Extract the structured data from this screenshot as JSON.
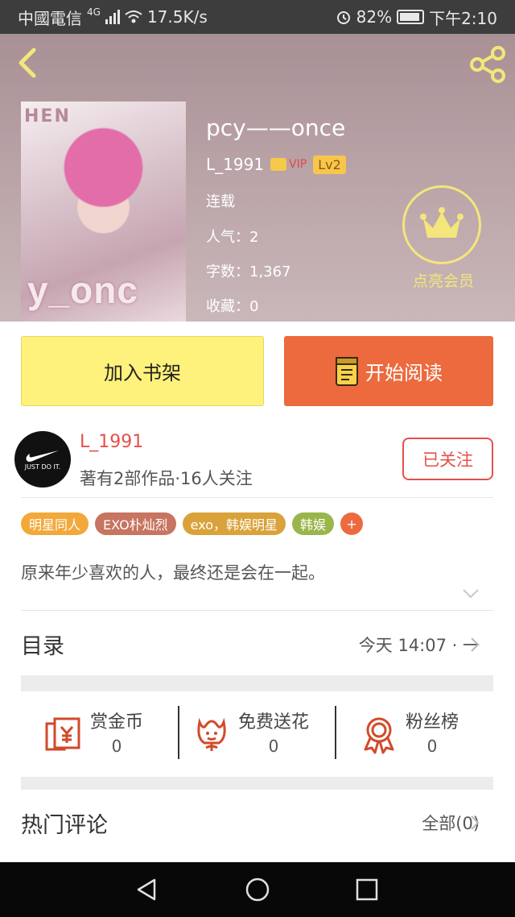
{
  "status_bar": {
    "carrier": "中國電信",
    "network": "4G",
    "speed": "17.5K/s",
    "battery": "82%",
    "time": "下午2:10"
  },
  "book": {
    "title": "pcy——once",
    "author": "L_1991",
    "vip_badge": "VIP",
    "level": "Lv2",
    "status": "连载",
    "popularity": "人气：2",
    "word_count": "字数：1,367",
    "favorites": "收藏：0",
    "cover_text": "y_onc",
    "cover_top_text": "HEN"
  },
  "vip_member": {
    "label": "点亮会员"
  },
  "actions": {
    "add_shelf": "加入书架",
    "start_read": "开始阅读"
  },
  "author_card": {
    "name": "L_1991",
    "stats": "著有2部作品·16人关注",
    "follow_label": "已关注",
    "avatar_text": "JUST DO IT."
  },
  "tags": [
    {
      "label": "明星同人",
      "color": "#f2a93b"
    },
    {
      "label": "EXO朴灿烈",
      "color": "#c77460"
    },
    {
      "label": "exo，韩娱明星",
      "color": "#d9a23a"
    },
    {
      "label": "韩娱",
      "color": "#9ab54a"
    },
    {
      "label": "+",
      "color": "#ec6a3e"
    }
  ],
  "intro": "原来年少喜欢的人，最终还是会在一起。",
  "toc": {
    "label": "目录",
    "status": "今天 14:07 · 一"
  },
  "stats": [
    {
      "label": "赏金币",
      "value": "0",
      "icon": "red-envelope-icon"
    },
    {
      "label": "免费送花",
      "value": "0",
      "icon": "flower-icon"
    },
    {
      "label": "粉丝榜",
      "value": "0",
      "icon": "medal-icon"
    }
  ],
  "comments": {
    "label": "热门评论",
    "all": "全部(0)"
  },
  "colors": {
    "accent": "#ec6a3e",
    "author_red": "#e6504a",
    "shelf_yellow": "#fff27c",
    "vip_yellow": "#f4e67a"
  }
}
